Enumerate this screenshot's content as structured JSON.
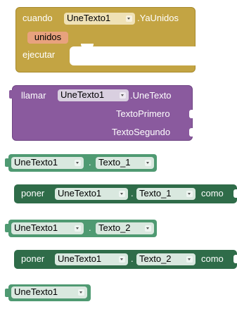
{
  "colors": {
    "event_block": "#c3a443",
    "event_dark": "#a88a2c",
    "call_block": "#8a5a9e",
    "call_dark": "#6e4482",
    "component_block": "#4f9a72",
    "set_block": "#2f6c49",
    "dropdown_light": "#d9e8df",
    "dropdown_purple": "#d9cfe0",
    "param": "#e8a27e"
  },
  "event": {
    "cuando": "cuando",
    "component": "UneTexto1",
    "event_name": ".YaUnidos",
    "param": "unidos",
    "ejecutar": "ejecutar"
  },
  "call": {
    "llamar": "llamar",
    "component": "UneTexto1",
    "method": ".UneTexto",
    "arg1": "TextoPrimero",
    "arg2": "TextoSegundo"
  },
  "getter1": {
    "component": "UneTexto1",
    "dot": ".",
    "property": "Texto_1"
  },
  "setter1": {
    "poner": "poner",
    "component": "UneTexto1",
    "dot": ".",
    "property": "Texto_1",
    "como": "como"
  },
  "getter2": {
    "component": "UneTexto1",
    "dot": ".",
    "property": "Texto_2"
  },
  "setter2": {
    "poner": "poner",
    "component": "UneTexto1",
    "dot": ".",
    "property": "Texto_2",
    "como": "como"
  },
  "component_ref": {
    "component": "UneTexto1"
  },
  "icons": {
    "dropdown": "chevron-down-icon",
    "socket": "input-socket-icon"
  }
}
